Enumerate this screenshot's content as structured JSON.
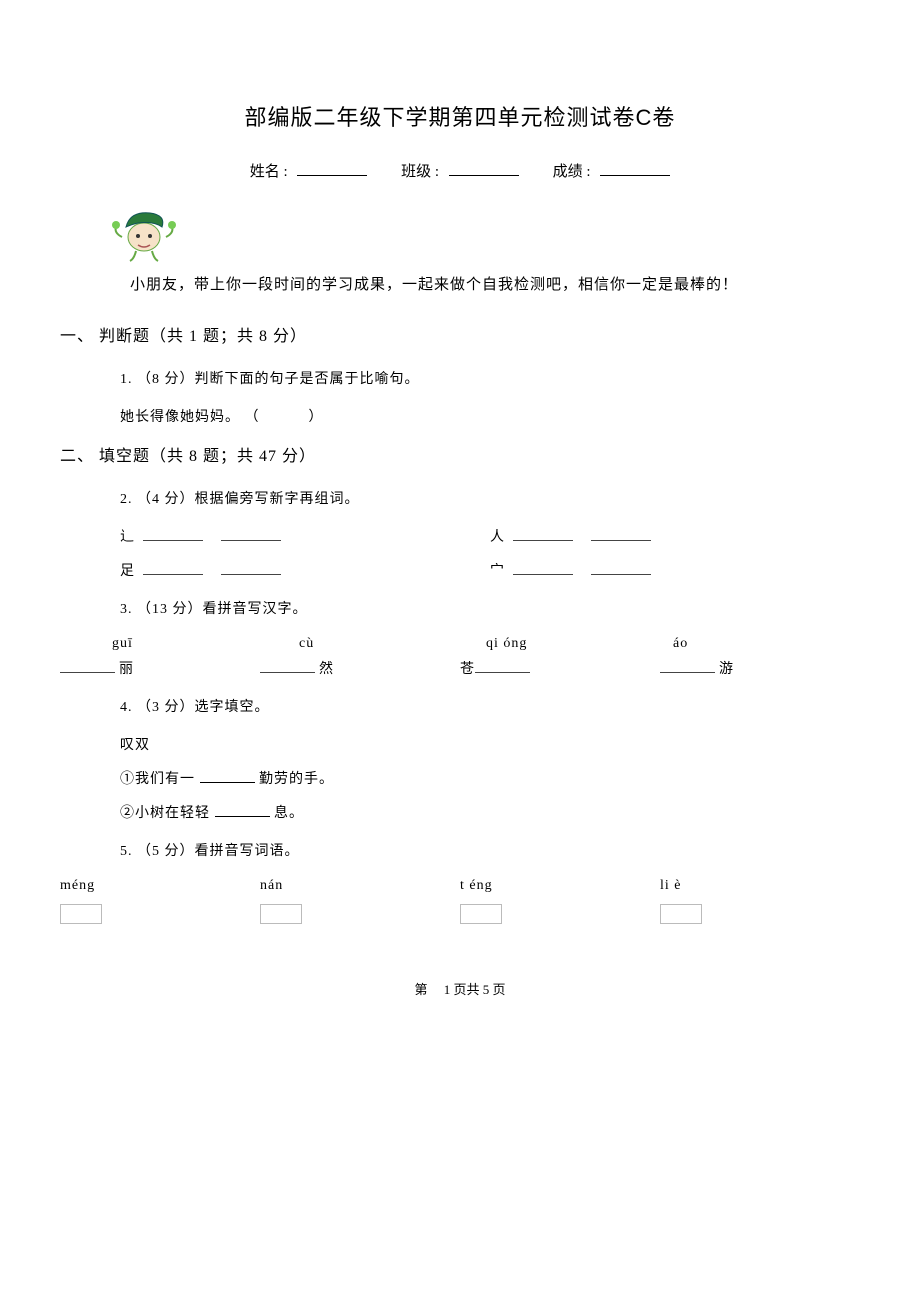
{
  "title": "部编版二年级下学期第四单元检测试卷C卷",
  "info": {
    "name_label": "姓名 :",
    "class_label": "班级 :",
    "score_label": "成绩 :"
  },
  "intro": "小朋友，带上你一段时间的学习成果，一起来做个自我检测吧，相信你一定是最棒的！",
  "section1": {
    "title": "一、 判断题（共 1 题；共 8 分）",
    "q1": "1. （8 分）判断下面的句子是否属于比喻句。",
    "q1_line": "她长得像她妈妈。 （",
    "q1_line_close": "）"
  },
  "section2": {
    "title": "二、 填空题（共 8 题；共 47 分）",
    "q2": "2. （4 分）根据偏旁写新字再组词。",
    "q2_rowA": {
      "left_label": "辶",
      "right_label": "人"
    },
    "q2_rowB": {
      "left_label": "足",
      "right_label": "宀"
    },
    "q3": "3. （13 分）看拼音写汉字。",
    "q3_pinyin": {
      "a": "guī",
      "b": "cù",
      "c": "qi óng",
      "d": "áo"
    },
    "q3_hanzi": {
      "a": "丽",
      "b": "然",
      "c_prefix": "苍",
      "d": "游"
    },
    "q4": "4. （3 分）选字填空。",
    "q4_words": "叹双",
    "q4_l1_prefix": "①我们有一",
    "q4_l1_suffix": "勤劳的手。",
    "q4_l2_prefix": "②小树在轻轻",
    "q4_l2_suffix": "息。",
    "q5": "5. （5 分）看拼音写词语。",
    "q5_pinyin": {
      "a": "méng",
      "b": "nán",
      "c": "t éng",
      "d": "li è"
    }
  },
  "pager_prefix": "第",
  "pager_page": "1 页共 5 页"
}
